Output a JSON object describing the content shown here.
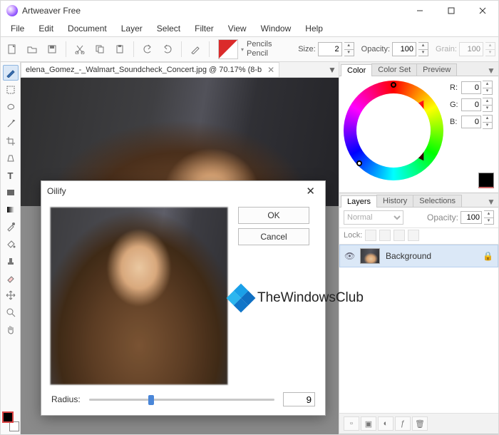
{
  "app_title": "Artweaver Free",
  "menu": [
    "File",
    "Edit",
    "Document",
    "Layer",
    "Select",
    "Filter",
    "View",
    "Window",
    "Help"
  ],
  "toolbar": {
    "brush_category": "Pencils",
    "brush_variant": "Pencil",
    "size_label": "Size:",
    "size_value": "2",
    "opacity_label": "Opacity:",
    "opacity_value": "100",
    "grain_label": "Grain:",
    "grain_value": "100"
  },
  "document": {
    "tab_label": "elena_Gomez_-_Walmart_Soundcheck_Concert.jpg @ 70.17% (8-b"
  },
  "tools": [
    {
      "name": "brush-tool",
      "icon": "brush",
      "selected": true
    },
    {
      "name": "marquee-tool",
      "icon": "rect"
    },
    {
      "name": "lasso-tool",
      "icon": "lasso"
    },
    {
      "name": "wand-tool",
      "icon": "wand"
    },
    {
      "name": "crop-tool",
      "icon": "crop"
    },
    {
      "name": "perspective-tool",
      "icon": "persp"
    },
    {
      "name": "text-tool",
      "icon": "text"
    },
    {
      "name": "shape-tool",
      "icon": "shape"
    },
    {
      "name": "gradient-tool",
      "icon": "grad"
    },
    {
      "name": "dropper-tool",
      "icon": "drop"
    },
    {
      "name": "fill-tool",
      "icon": "fill"
    },
    {
      "name": "stamp-tool",
      "icon": "stamp"
    },
    {
      "name": "eraser-tool",
      "icon": "eraser"
    },
    {
      "name": "move-tool",
      "icon": "move"
    },
    {
      "name": "zoom-tool",
      "icon": "zoom"
    },
    {
      "name": "hand-tool",
      "icon": "hand"
    }
  ],
  "color_panel": {
    "tabs": [
      "Color",
      "Color Set",
      "Preview"
    ],
    "selected_tab": 0,
    "r_label": "R:",
    "r_value": "0",
    "g_label": "G:",
    "g_value": "0",
    "b_label": "B:",
    "b_value": "0"
  },
  "layers_panel": {
    "tabs": [
      "Layers",
      "History",
      "Selections"
    ],
    "selected_tab": 0,
    "blend_mode": "Normal",
    "opacity_label": "Opacity:",
    "opacity_value": "100",
    "lock_label": "Lock:",
    "layers": [
      {
        "name": "Background",
        "visible": true,
        "locked": true
      }
    ]
  },
  "dialog": {
    "title": "Oilify",
    "ok": "OK",
    "cancel": "Cancel",
    "radius_label": "Radius:",
    "radius_value": "9"
  },
  "watermark": "TheWindowsClub"
}
